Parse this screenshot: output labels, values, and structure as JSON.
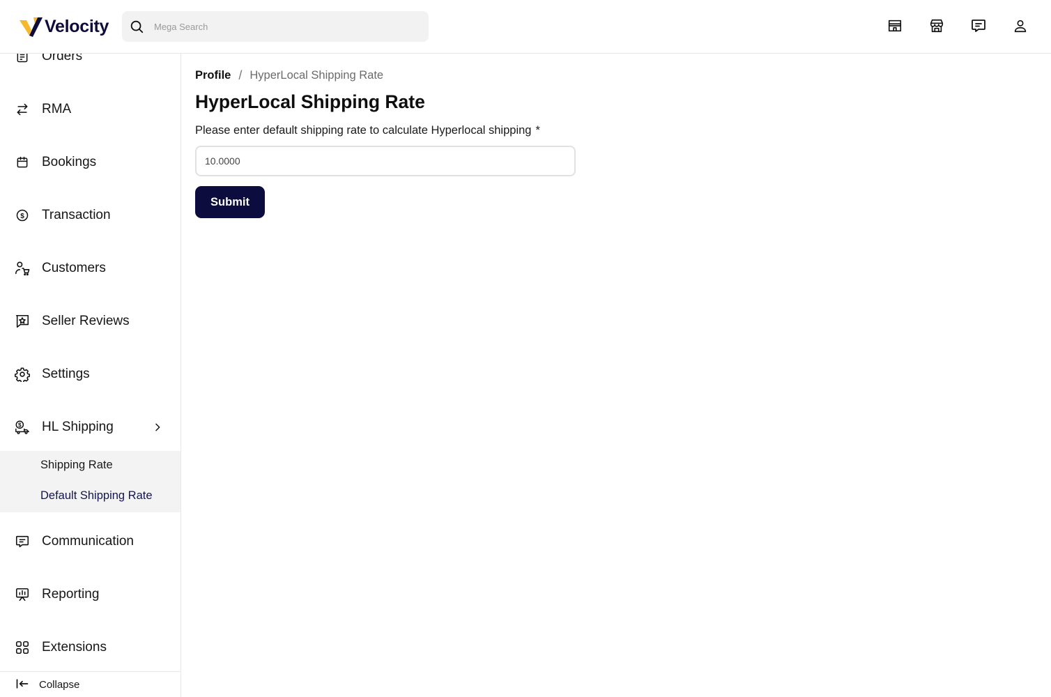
{
  "header": {
    "logo_text": "Velocity",
    "search_placeholder": "Mega Search",
    "icons": [
      "storefront-icon",
      "store-icon",
      "chat-icon",
      "user-icon"
    ]
  },
  "sidebar": {
    "items": [
      {
        "label": "Orders",
        "icon": "orders-icon"
      },
      {
        "label": "RMA",
        "icon": "arrows-exchange-icon"
      },
      {
        "label": "Bookings",
        "icon": "calendar-icon"
      },
      {
        "label": "Transaction",
        "icon": "dollar-circle-icon"
      },
      {
        "label": "Customers",
        "icon": "customers-cart-icon"
      },
      {
        "label": "Seller Reviews",
        "icon": "review-star-icon"
      },
      {
        "label": "Settings",
        "icon": "gear-icon"
      },
      {
        "label": "HL Shipping",
        "icon": "delivery-truck-icon"
      },
      {
        "label": "Communication",
        "icon": "chat-icon"
      },
      {
        "label": "Reporting",
        "icon": "presentation-chart-icon"
      },
      {
        "label": "Extensions",
        "icon": "grid-apps-icon"
      }
    ],
    "submenu": [
      {
        "label": "Shipping Rate"
      },
      {
        "label": "Default Shipping Rate"
      }
    ],
    "collapse_label": "Collapse"
  },
  "breadcrumb": {
    "parent": "Profile",
    "separator": "/",
    "current": "HyperLocal Shipping Rate"
  },
  "page": {
    "title": "HyperLocal Shipping Rate",
    "field_label": "Please enter default shipping rate to calculate Hyperlocal shipping",
    "required_mark": "*",
    "rate_value": "10.0000",
    "submit_label": "Submit"
  },
  "colors": {
    "brand_navy": "#0c0c3f",
    "logo_gold": "#f5b82e",
    "submenu_bg": "#f3f3f3"
  }
}
